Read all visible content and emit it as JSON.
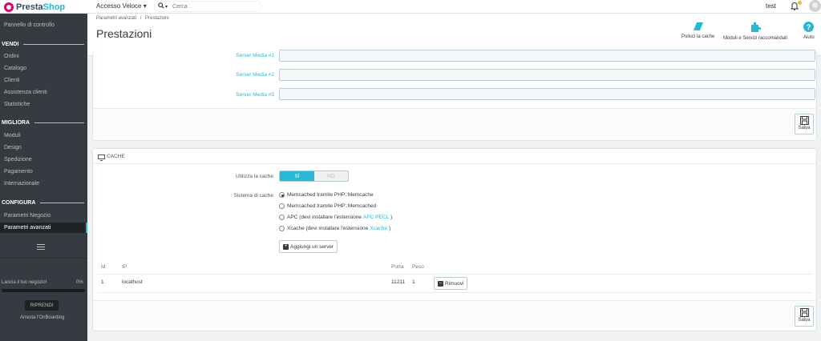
{
  "topbar": {
    "logo_prefix": "Presta",
    "logo_suffix": "Shop",
    "quick_access": "Accesso Veloce ▾",
    "search_icon": "search-icon",
    "search_placeholder": "Cerca",
    "user": "test"
  },
  "sidebar": {
    "dashboard": "Pannello di controllo",
    "sections": [
      {
        "title": "VENDI",
        "items": [
          "Ordini",
          "Catalogo",
          "Clienti",
          "Assistenza clienti",
          "Statistiche"
        ]
      },
      {
        "title": "MIGLIORA",
        "items": [
          "Moduli",
          "Design",
          "Spedizione",
          "Pagamento",
          "Internazionale"
        ]
      },
      {
        "title": "CONFIGURA",
        "items": [
          "Parametri Negozio",
          "Parametri avanzati"
        ]
      }
    ],
    "onboarding": {
      "label": "Lancia il tuo negozio!",
      "progress_text": "0%",
      "progress": 0,
      "resume_button": "RIPRENDI",
      "stop_link": "Arresta l'OnBoarding"
    }
  },
  "header": {
    "breadcrumb_parent": "Parametri avanzati",
    "breadcrumb_sep": "/",
    "breadcrumb_current": "Prestazioni",
    "title": "Prestazioni",
    "toolbar": {
      "clear_cache": "Pulisci la cache",
      "modules": "Moduli e Servizi raccomandati",
      "help": "Aiuto"
    }
  },
  "media_panel": {
    "fields": [
      {
        "label": "Server Media #1",
        "value": ""
      },
      {
        "label": "Server Media #2",
        "value": ""
      },
      {
        "label": "Server Media #3",
        "value": ""
      }
    ],
    "save_label": "Salva"
  },
  "cache_panel": {
    "heading": "CACHE",
    "use_cache_label": "Utilizza la cache",
    "switch_on": "SÌ",
    "switch_off": "NO",
    "system_label": "Sistema di cache",
    "options": [
      {
        "text": "Memcached tramite PHP::Memcache",
        "link": "",
        "suffix": "",
        "checked": true
      },
      {
        "text": "Memcached tramite PHP::Memcached",
        "link": "",
        "suffix": "",
        "checked": false
      },
      {
        "text": "APC (devi installare l'estensione",
        "link": "APC PECL",
        "suffix": ")",
        "checked": false
      },
      {
        "text": "Xcache (devi installare l'estensione",
        "link": "Xcache",
        "suffix": ")",
        "checked": false
      }
    ],
    "add_server": "Aggiungi un server",
    "table": {
      "headers": [
        "Id",
        "IP",
        "Porta",
        "Peso"
      ],
      "rows": [
        {
          "id": "1",
          "ip": "localhost",
          "port": "11211",
          "weight": "1"
        }
      ],
      "remove_label": "Rimuovi"
    },
    "save_label": "Salva"
  },
  "colors": {
    "accent": "#25b9d7",
    "sidebar_bg": "#363a41",
    "brand_pink": "#df0067"
  }
}
